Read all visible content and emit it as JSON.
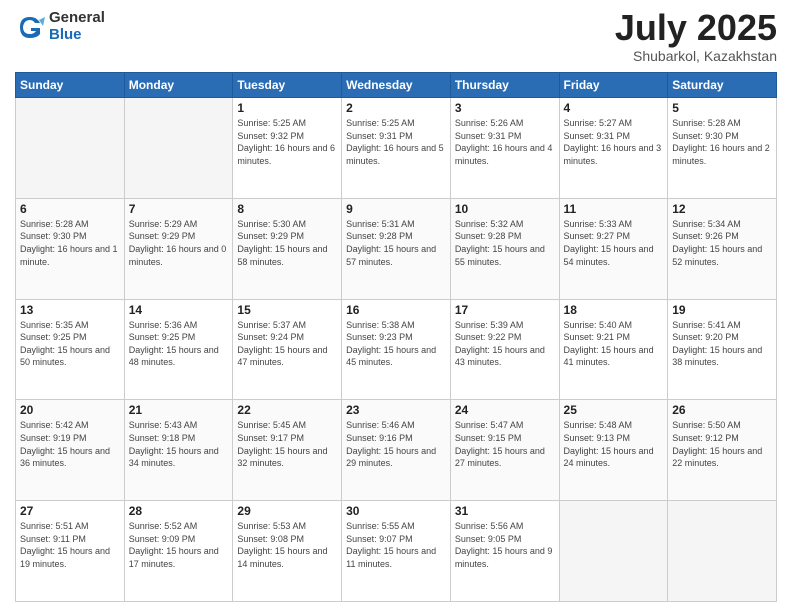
{
  "header": {
    "logo_general": "General",
    "logo_blue": "Blue",
    "title": "July 2025",
    "location": "Shubarkol, Kazakhstan"
  },
  "weekdays": [
    "Sunday",
    "Monday",
    "Tuesday",
    "Wednesday",
    "Thursday",
    "Friday",
    "Saturday"
  ],
  "weeks": [
    [
      {
        "day": "",
        "empty": true
      },
      {
        "day": "",
        "empty": true
      },
      {
        "day": "1",
        "sunrise": "Sunrise: 5:25 AM",
        "sunset": "Sunset: 9:32 PM",
        "daylight": "Daylight: 16 hours and 6 minutes."
      },
      {
        "day": "2",
        "sunrise": "Sunrise: 5:25 AM",
        "sunset": "Sunset: 9:31 PM",
        "daylight": "Daylight: 16 hours and 5 minutes."
      },
      {
        "day": "3",
        "sunrise": "Sunrise: 5:26 AM",
        "sunset": "Sunset: 9:31 PM",
        "daylight": "Daylight: 16 hours and 4 minutes."
      },
      {
        "day": "4",
        "sunrise": "Sunrise: 5:27 AM",
        "sunset": "Sunset: 9:31 PM",
        "daylight": "Daylight: 16 hours and 3 minutes."
      },
      {
        "day": "5",
        "sunrise": "Sunrise: 5:28 AM",
        "sunset": "Sunset: 9:30 PM",
        "daylight": "Daylight: 16 hours and 2 minutes."
      }
    ],
    [
      {
        "day": "6",
        "sunrise": "Sunrise: 5:28 AM",
        "sunset": "Sunset: 9:30 PM",
        "daylight": "Daylight: 16 hours and 1 minute."
      },
      {
        "day": "7",
        "sunrise": "Sunrise: 5:29 AM",
        "sunset": "Sunset: 9:29 PM",
        "daylight": "Daylight: 16 hours and 0 minutes."
      },
      {
        "day": "8",
        "sunrise": "Sunrise: 5:30 AM",
        "sunset": "Sunset: 9:29 PM",
        "daylight": "Daylight: 15 hours and 58 minutes."
      },
      {
        "day": "9",
        "sunrise": "Sunrise: 5:31 AM",
        "sunset": "Sunset: 9:28 PM",
        "daylight": "Daylight: 15 hours and 57 minutes."
      },
      {
        "day": "10",
        "sunrise": "Sunrise: 5:32 AM",
        "sunset": "Sunset: 9:28 PM",
        "daylight": "Daylight: 15 hours and 55 minutes."
      },
      {
        "day": "11",
        "sunrise": "Sunrise: 5:33 AM",
        "sunset": "Sunset: 9:27 PM",
        "daylight": "Daylight: 15 hours and 54 minutes."
      },
      {
        "day": "12",
        "sunrise": "Sunrise: 5:34 AM",
        "sunset": "Sunset: 9:26 PM",
        "daylight": "Daylight: 15 hours and 52 minutes."
      }
    ],
    [
      {
        "day": "13",
        "sunrise": "Sunrise: 5:35 AM",
        "sunset": "Sunset: 9:25 PM",
        "daylight": "Daylight: 15 hours and 50 minutes."
      },
      {
        "day": "14",
        "sunrise": "Sunrise: 5:36 AM",
        "sunset": "Sunset: 9:25 PM",
        "daylight": "Daylight: 15 hours and 48 minutes."
      },
      {
        "day": "15",
        "sunrise": "Sunrise: 5:37 AM",
        "sunset": "Sunset: 9:24 PM",
        "daylight": "Daylight: 15 hours and 47 minutes."
      },
      {
        "day": "16",
        "sunrise": "Sunrise: 5:38 AM",
        "sunset": "Sunset: 9:23 PM",
        "daylight": "Daylight: 15 hours and 45 minutes."
      },
      {
        "day": "17",
        "sunrise": "Sunrise: 5:39 AM",
        "sunset": "Sunset: 9:22 PM",
        "daylight": "Daylight: 15 hours and 43 minutes."
      },
      {
        "day": "18",
        "sunrise": "Sunrise: 5:40 AM",
        "sunset": "Sunset: 9:21 PM",
        "daylight": "Daylight: 15 hours and 41 minutes."
      },
      {
        "day": "19",
        "sunrise": "Sunrise: 5:41 AM",
        "sunset": "Sunset: 9:20 PM",
        "daylight": "Daylight: 15 hours and 38 minutes."
      }
    ],
    [
      {
        "day": "20",
        "sunrise": "Sunrise: 5:42 AM",
        "sunset": "Sunset: 9:19 PM",
        "daylight": "Daylight: 15 hours and 36 minutes."
      },
      {
        "day": "21",
        "sunrise": "Sunrise: 5:43 AM",
        "sunset": "Sunset: 9:18 PM",
        "daylight": "Daylight: 15 hours and 34 minutes."
      },
      {
        "day": "22",
        "sunrise": "Sunrise: 5:45 AM",
        "sunset": "Sunset: 9:17 PM",
        "daylight": "Daylight: 15 hours and 32 minutes."
      },
      {
        "day": "23",
        "sunrise": "Sunrise: 5:46 AM",
        "sunset": "Sunset: 9:16 PM",
        "daylight": "Daylight: 15 hours and 29 minutes."
      },
      {
        "day": "24",
        "sunrise": "Sunrise: 5:47 AM",
        "sunset": "Sunset: 9:15 PM",
        "daylight": "Daylight: 15 hours and 27 minutes."
      },
      {
        "day": "25",
        "sunrise": "Sunrise: 5:48 AM",
        "sunset": "Sunset: 9:13 PM",
        "daylight": "Daylight: 15 hours and 24 minutes."
      },
      {
        "day": "26",
        "sunrise": "Sunrise: 5:50 AM",
        "sunset": "Sunset: 9:12 PM",
        "daylight": "Daylight: 15 hours and 22 minutes."
      }
    ],
    [
      {
        "day": "27",
        "sunrise": "Sunrise: 5:51 AM",
        "sunset": "Sunset: 9:11 PM",
        "daylight": "Daylight: 15 hours and 19 minutes."
      },
      {
        "day": "28",
        "sunrise": "Sunrise: 5:52 AM",
        "sunset": "Sunset: 9:09 PM",
        "daylight": "Daylight: 15 hours and 17 minutes."
      },
      {
        "day": "29",
        "sunrise": "Sunrise: 5:53 AM",
        "sunset": "Sunset: 9:08 PM",
        "daylight": "Daylight: 15 hours and 14 minutes."
      },
      {
        "day": "30",
        "sunrise": "Sunrise: 5:55 AM",
        "sunset": "Sunset: 9:07 PM",
        "daylight": "Daylight: 15 hours and 11 minutes."
      },
      {
        "day": "31",
        "sunrise": "Sunrise: 5:56 AM",
        "sunset": "Sunset: 9:05 PM",
        "daylight": "Daylight: 15 hours and 9 minutes."
      },
      {
        "day": "",
        "empty": true
      },
      {
        "day": "",
        "empty": true
      }
    ]
  ]
}
